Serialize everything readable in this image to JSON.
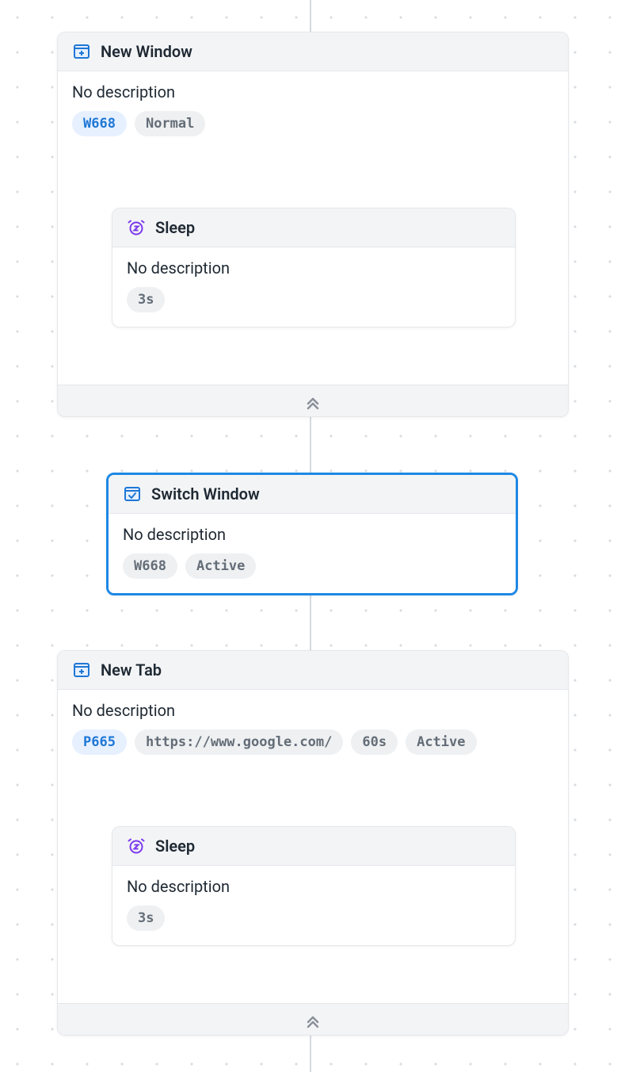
{
  "nodes": {
    "new_window": {
      "title": "New Window",
      "desc": "No description",
      "id_pill": "W668",
      "mode_pill": "Normal"
    },
    "sleep1": {
      "title": "Sleep",
      "desc": "No description",
      "duration_pill": "3s"
    },
    "switch_window": {
      "title": "Switch Window",
      "desc": "No description",
      "id_pill": "W668",
      "state_pill": "Active"
    },
    "new_tab": {
      "title": "New Tab",
      "desc": "No description",
      "id_pill": "P665",
      "url_pill": "https://www.google.com/",
      "timeout_pill": "60s",
      "state_pill": "Active"
    },
    "sleep2": {
      "title": "Sleep",
      "desc": "No description",
      "duration_pill": "3s"
    }
  },
  "icons": {
    "plus_window": "plus-window-icon",
    "check_window": "check-window-icon",
    "sleep": "alarm-snooze-icon",
    "collapse": "chevron-double-up-icon"
  }
}
